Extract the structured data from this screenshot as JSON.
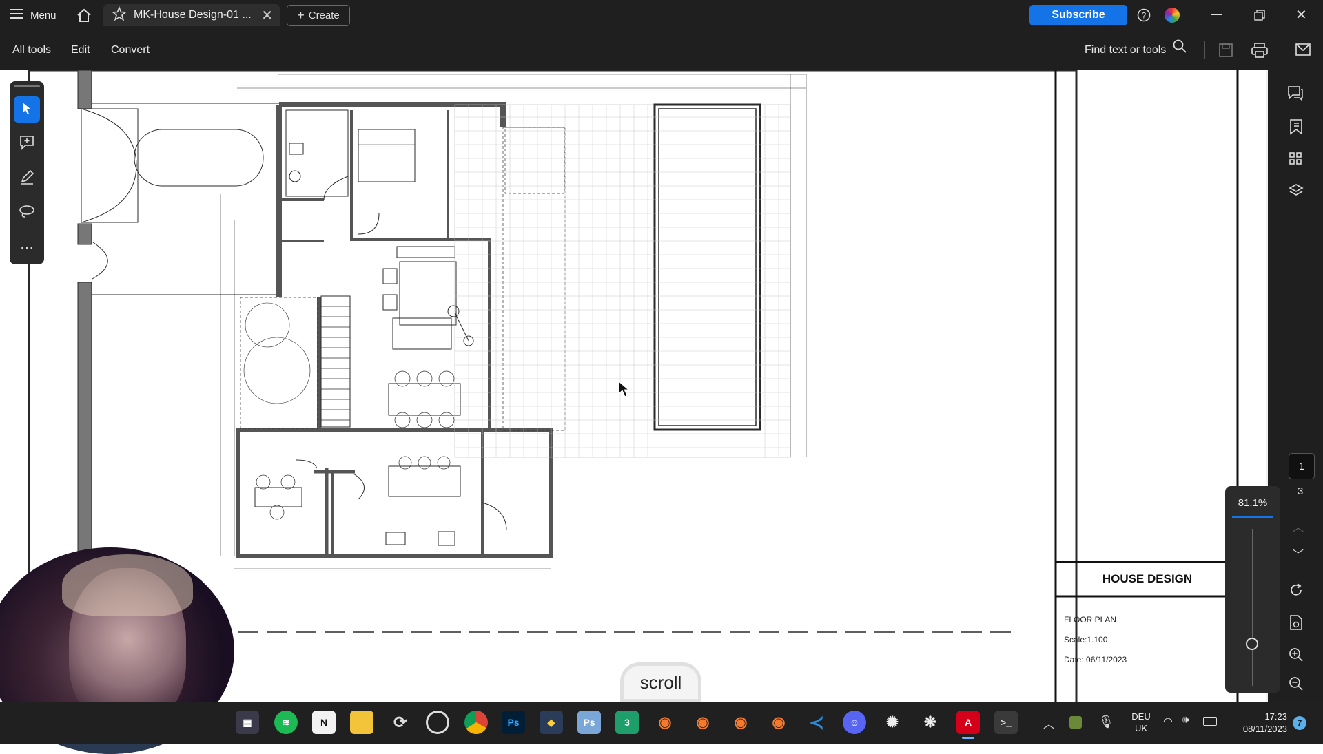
{
  "titlebar": {
    "menu_label": "Menu",
    "tab_title": "MK-House Design-01 ...",
    "create_label": "Create",
    "subscribe_label": "Subscribe"
  },
  "menubar": {
    "items": [
      "All tools",
      "Edit",
      "Convert"
    ],
    "find_label": "Find text or tools"
  },
  "title_block": {
    "project": "HOUSE DESIGN",
    "sheet": "FLOOR PLAN",
    "scale": "Scale:1.100",
    "date": "Date: 06/11/2023"
  },
  "page_nav": {
    "current_page": "1",
    "total_pages": "3"
  },
  "zoom": {
    "level": "81.1%",
    "slider_level": 0.25
  },
  "overlay": {
    "scroll_label": "scroll"
  },
  "taskbar": {
    "lang_top": "DEU",
    "lang_bottom": "UK",
    "time": "17:23",
    "date": "08/11/2023",
    "notification_count": "7",
    "apps": [
      "windows-start",
      "spotify",
      "notion",
      "file-explorer",
      "sync",
      "chrome-alt",
      "chrome",
      "photoshop",
      "affinity",
      "photoshop-alt",
      "excel-like",
      "blender",
      "blender",
      "blender",
      "blender",
      "vscode",
      "discord",
      "chatgpt",
      "settings",
      "acrobat",
      "terminal"
    ]
  },
  "colors": {
    "accent": "#1473e6",
    "chrome_bg": "#1f1f1f",
    "drawing_line": "#2a2a2a"
  }
}
